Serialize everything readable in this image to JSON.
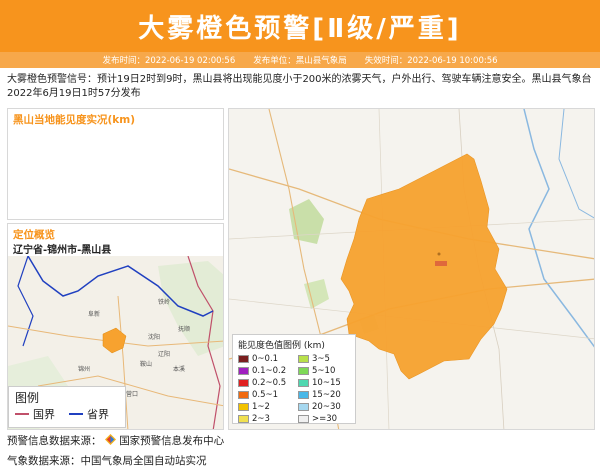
{
  "header": {
    "title": "大雾橙色预警[Ⅱ级/严重]",
    "issue_time": "发布时间：2022-06-19 02:00:56",
    "issuer": "发布单位：黑山县气象局",
    "expire_time": "失效时间：2022-06-19 10:00:56"
  },
  "description": "大雾橙色预警信号：预计19日2时到9时，黑山县将出现能见度小于200米的浓雾天气，户外出行、驾驶车辆注意安全。黑山县气象台2022年6月19日1时57分发布",
  "visibility_panel": {
    "title": "黑山当地能见度实况(km)"
  },
  "location_panel": {
    "title": "定位概览",
    "region": "辽宁省-锦州市-黑山县",
    "legend_title": "图例",
    "legend_national": "国界",
    "legend_provincial": "省界",
    "place_labels": [
      "沈阳",
      "鞍山",
      "辽阳",
      "营口",
      "锦州",
      "阜新",
      "抚顺",
      "本溪",
      "铁岭"
    ]
  },
  "visibility_legend": {
    "title": "能见度色值图例 (km)",
    "items": [
      {
        "label": "0~0.1",
        "color": "#7a1f1f"
      },
      {
        "label": "3~5",
        "color": "#b8e04a"
      },
      {
        "label": "0.1~0.2",
        "color": "#a020c0"
      },
      {
        "label": "5~10",
        "color": "#7ed957"
      },
      {
        "label": "0.2~0.5",
        "color": "#e02020"
      },
      {
        "label": "10~15",
        "color": "#4fd8b0"
      },
      {
        "label": "0.5~1",
        "color": "#f06a10"
      },
      {
        "label": "15~20",
        "color": "#4ab8e8"
      },
      {
        "label": "1~2",
        "color": "#f2c200"
      },
      {
        "label": "20~30",
        "color": "#a6d8f0"
      },
      {
        "label": "2~3",
        "color": "#f0e050"
      },
      {
        "label": ">=30",
        "color": "#f0f0f0"
      }
    ]
  },
  "footer": {
    "warning_source": "预警信息数据来源：",
    "warning_source_org": "国家预警信息发布中心",
    "weather_source": "气象数据来源：中国气象局全国自动站实况"
  },
  "colors": {
    "accent": "#f7941d",
    "warning_area": "#f7a22f",
    "national_border": "#c0506a",
    "provincial_border": "#2040c0"
  },
  "icons": [
    "warning-center-logo-icon"
  ]
}
